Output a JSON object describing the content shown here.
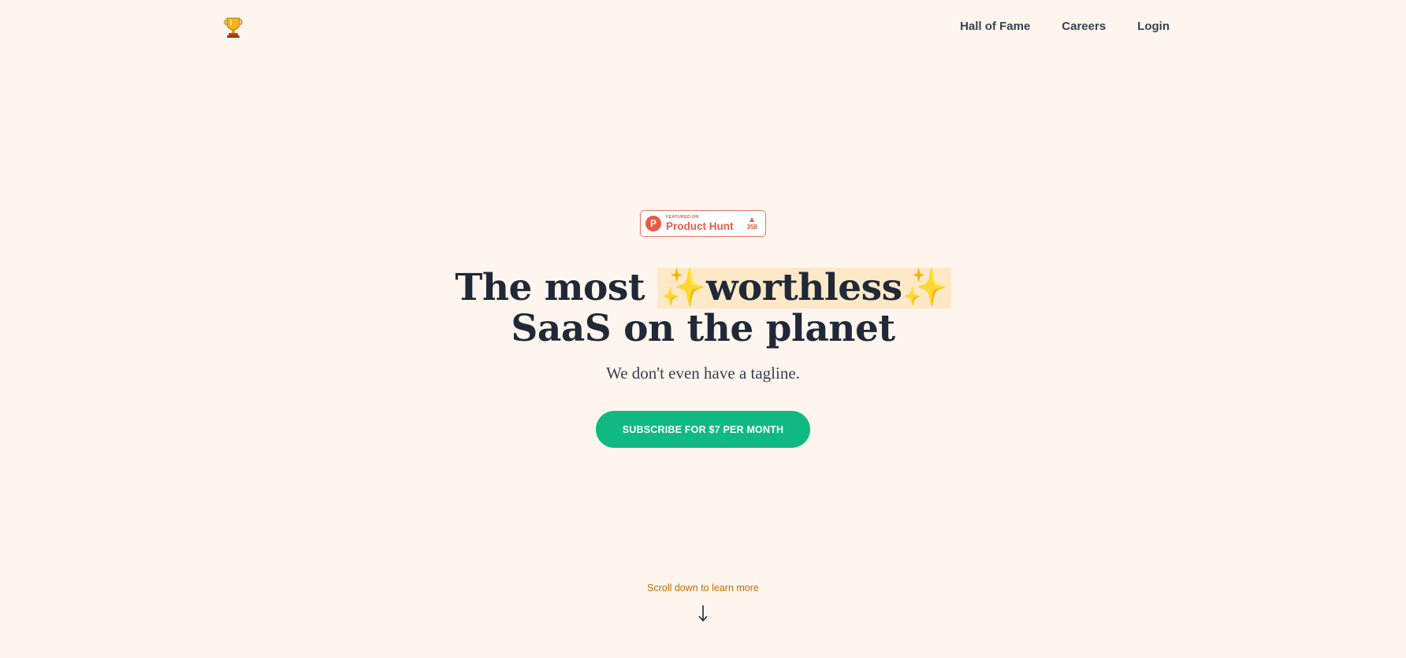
{
  "header": {
    "logo_icon": "trophy-icon",
    "nav": [
      {
        "label": "Hall of Fame"
      },
      {
        "label": "Careers"
      },
      {
        "label": "Login"
      }
    ]
  },
  "badge": {
    "featured_text": "FEATURED ON",
    "name": "Product Hunt",
    "logo_letter": "P",
    "vote_count": "358"
  },
  "hero": {
    "line1_prefix": "The most ",
    "highlight_word": "worthless",
    "sparkle": "✨",
    "line2": "SaaS on the planet",
    "tagline": "We don't even have a tagline."
  },
  "cta": {
    "label": "SUBSCRIBE FOR $7 PER MONTH"
  },
  "scroll": {
    "label": "Scroll down to learn more",
    "icon": "arrow-down-icon"
  },
  "colors": {
    "background": "#fef6ee",
    "accent": "#10b981",
    "highlight": "#fde8c8",
    "heading": "#1f2937",
    "product_hunt": "#ea5a47",
    "scroll_text": "#c56b00"
  }
}
